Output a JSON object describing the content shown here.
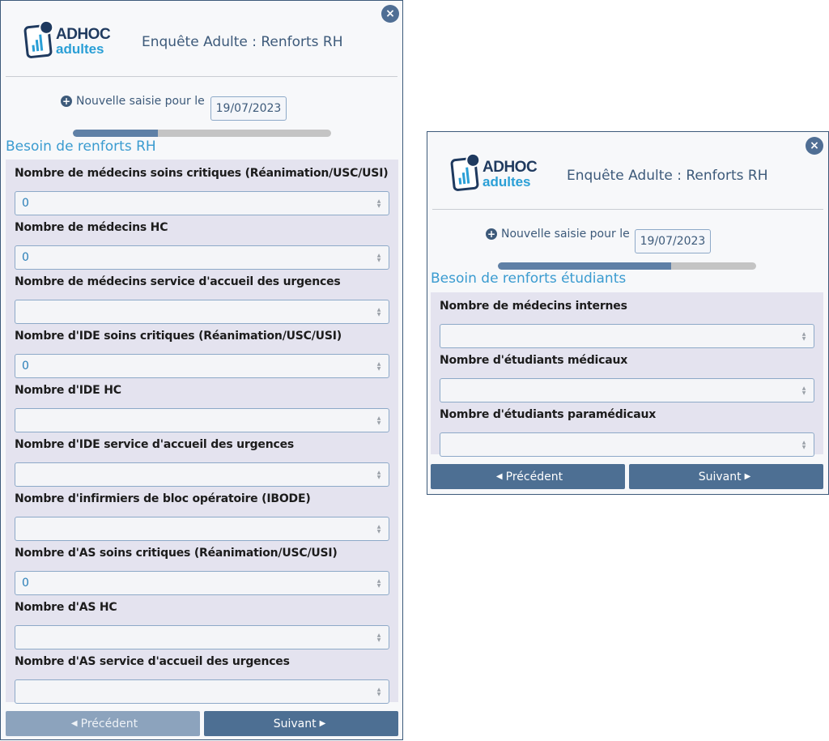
{
  "left_panel": {
    "close_icon": "×",
    "logo": {
      "title": "ADHOC",
      "subtitle": "adultes"
    },
    "app_title": "Enquête Adulte : Renforts RH",
    "new_entry_label": "Nouvelle saisie pour le",
    "date": "19/07/2023",
    "progress": 0.33,
    "section_title": "Besoin de renforts RH",
    "fields": [
      {
        "label": "Nombre de médecins soins critiques (Réanimation/USC/USI)",
        "value": "0"
      },
      {
        "label": "Nombre de médecins HC",
        "value": "0"
      },
      {
        "label": "Nombre de médecins service d'accueil des urgences",
        "value": ""
      },
      {
        "label": "Nombre d'IDE soins critiques (Réanimation/USC/USI)",
        "value": "0"
      },
      {
        "label": "Nombre d'IDE HC",
        "value": ""
      },
      {
        "label": "Nombre d'IDE service d'accueil des urgences",
        "value": ""
      },
      {
        "label": "Nombre d'infirmiers de bloc opératoire (IBODE)",
        "value": ""
      },
      {
        "label": "Nombre d'AS soins critiques (Réanimation/USC/USI)",
        "value": "0"
      },
      {
        "label": "Nombre d'AS HC",
        "value": ""
      },
      {
        "label": "Nombre d'AS service d'accueil des urgences",
        "value": ""
      }
    ],
    "prev_label": "Précédent",
    "next_label": "Suivant"
  },
  "right_panel": {
    "close_icon": "×",
    "logo": {
      "title": "ADHOC",
      "subtitle": "adultes"
    },
    "app_title": "Enquête Adulte : Renforts RH",
    "new_entry_label": "Nouvelle saisie pour le",
    "date": "19/07/2023",
    "progress": 0.67,
    "section_title": "Besoin de renforts étudiants",
    "fields": [
      {
        "label": "Nombre de médecins internes",
        "value": ""
      },
      {
        "label": "Nombre d'étudiants médicaux",
        "value": ""
      },
      {
        "label": "Nombre d'étudiants paramédicaux",
        "value": ""
      }
    ],
    "prev_label": "Précédent",
    "next_label": "Suivant"
  },
  "colors": {
    "accent": "#4d6f93",
    "section_title": "#3a9bd0",
    "form_bg": "#e4e3ef",
    "progress_fill": "#5f80a6"
  },
  "icons": {
    "close": "close-icon",
    "plus": "plus-circle-icon",
    "prev": "caret-left-icon",
    "next": "caret-right-icon",
    "spinner": "number-spinner-icon"
  }
}
